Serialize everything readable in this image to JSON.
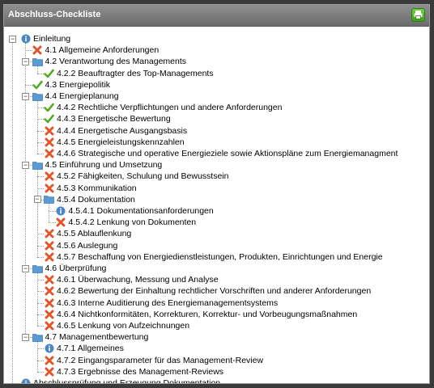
{
  "header": {
    "title": "Abschluss-Checkliste"
  },
  "colors": {
    "info": "#4a86c8",
    "cross": "#e0552a",
    "check": "#5aaa28",
    "folder": "#5b9bd5"
  },
  "tree": [
    {
      "label": "Einleitung",
      "icon": "info",
      "level": 0,
      "expander": "minus"
    },
    {
      "label": "4.1 Allgemeine Anforderungen",
      "icon": "cross",
      "level": 1
    },
    {
      "label": "4.2 Verantwortung des Managements",
      "icon": "folder",
      "level": 1,
      "expander": "minus"
    },
    {
      "label": "4.2.2 Beauftragter des Top-Managements",
      "icon": "check",
      "level": 2
    },
    {
      "label": "4.3 Energiepolitik",
      "icon": "check",
      "level": 1
    },
    {
      "label": "4.4 Energieplanung",
      "icon": "folder",
      "level": 1,
      "expander": "minus"
    },
    {
      "label": "4.4.2 Rechtliche Verpflichtungen und andere Anforderungen",
      "icon": "check",
      "level": 2
    },
    {
      "label": "4.4.3 Energetische Bewertung",
      "icon": "check",
      "level": 2
    },
    {
      "label": "4.4.4 Energetische Ausgangsbasis",
      "icon": "cross",
      "level": 2
    },
    {
      "label": "4.4.5 Energieleistungskennzahlen",
      "icon": "cross",
      "level": 2
    },
    {
      "label": "4.4.6 Strategische und operative Energieziele sowie Aktionspläne zum Energiemanagment",
      "icon": "cross",
      "level": 2
    },
    {
      "label": "4.5 Einführung und Umsetzung",
      "icon": "folder",
      "level": 1,
      "expander": "minus"
    },
    {
      "label": "4.5.2 Fähigkeiten, Schulung und Bewusstsein",
      "icon": "cross",
      "level": 2
    },
    {
      "label": "4.5.3 Kommunikation",
      "icon": "cross",
      "level": 2
    },
    {
      "label": "4.5.4 Dokumentation",
      "icon": "folder",
      "level": 2,
      "expander": "minus"
    },
    {
      "label": "4.5.4.1 Dokumentationsanforderungen",
      "icon": "info",
      "level": 3
    },
    {
      "label": "4.5.4.2 Lenkung von Dokumenten",
      "icon": "cross",
      "level": 3
    },
    {
      "label": "4.5.5 Ablauflenkung",
      "icon": "cross",
      "level": 2
    },
    {
      "label": "4.5.6 Auslegung",
      "icon": "cross",
      "level": 2
    },
    {
      "label": "4.5.7 Beschaffung von Energiedienstleistungen, Produkten, Einrichtungen und Energie",
      "icon": "cross",
      "level": 2
    },
    {
      "label": "4.6 Überprüfung",
      "icon": "folder",
      "level": 1,
      "expander": "minus"
    },
    {
      "label": "4.6.1 Überwachung, Messung und Analyse",
      "icon": "cross",
      "level": 2
    },
    {
      "label": "4.6.2 Bewertung der Einhaltung rechtlicher Vorschriften und anderer Anforderungen",
      "icon": "cross",
      "level": 2
    },
    {
      "label": "4.6.3 Interne Auditierung des Energiemanagementsystems",
      "icon": "cross",
      "level": 2
    },
    {
      "label": "4.6.4 Nichtkonformitäten, Korrekturen, Korrektur- und Vorbeugungsmaßnahmen",
      "icon": "cross",
      "level": 2
    },
    {
      "label": "4.6.5 Lenkung von Aufzeichnungen",
      "icon": "cross",
      "level": 2
    },
    {
      "label": "4.7 Managementbewertung",
      "icon": "folder",
      "level": 1,
      "expander": "minus"
    },
    {
      "label": "4.7.1 Allgemeines",
      "icon": "info",
      "level": 2
    },
    {
      "label": "4.7.2 Eingangsparameter für das Management-Review",
      "icon": "cross",
      "level": 2
    },
    {
      "label": "4.7.3 Ergebnisse des Management-Reviews",
      "icon": "cross",
      "level": 2
    },
    {
      "label": "Abschlussprüfung und Erzeugung Dokumentation",
      "icon": "info",
      "level": 0
    }
  ]
}
